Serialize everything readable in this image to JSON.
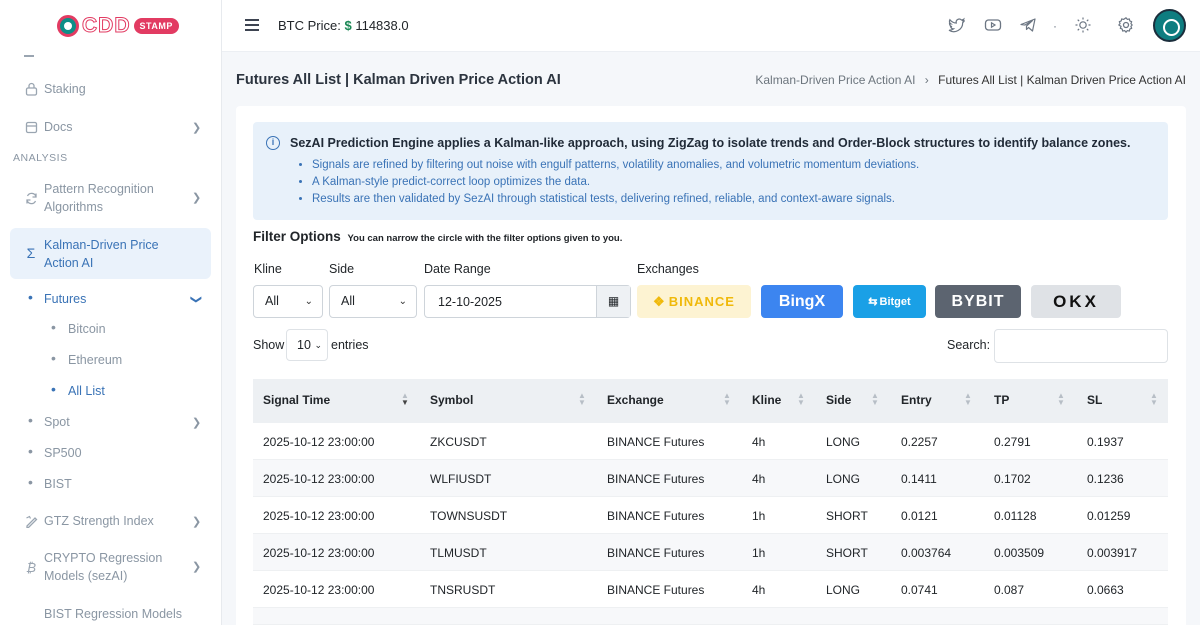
{
  "logo": {
    "text": "CDD",
    "badge": "STAMP"
  },
  "header": {
    "btc_label": "BTC Price:",
    "btc_currency": "$",
    "btc_value": "114838.0"
  },
  "sidebar": {
    "section_analysis": "ANALYSIS",
    "items": [
      {
        "label": "Staking"
      },
      {
        "label": "Docs"
      },
      {
        "label": "Pattern Recognition Algorithms"
      },
      {
        "label": "Kalman-Driven Price Action AI"
      },
      {
        "label": "Futures"
      },
      {
        "label": "Bitcoin"
      },
      {
        "label": "Ethereum"
      },
      {
        "label": "All List"
      },
      {
        "label": "Spot"
      },
      {
        "label": "SP500"
      },
      {
        "label": "BIST"
      },
      {
        "label": "GTZ Strength Index"
      },
      {
        "label": "CRYPTO Regression Models (sezAI)"
      },
      {
        "label": "BIST Regression Models"
      }
    ]
  },
  "page": {
    "title": "Futures All List | Kalman Driven Price Action AI",
    "breadcrumb": [
      "Kalman-Driven Price Action AI",
      "Futures All List | Kalman Driven Price Action AI"
    ],
    "breadcrumb_sep": "›"
  },
  "alert": {
    "head": "SezAI Prediction Engine applies a Kalman-like approach, using ZigZag to isolate trends and Order-Block structures to identify balance zones.",
    "bullets": [
      "Signals are refined by filtering out noise with engulf patterns, volatility anomalies, and volumetric momentum deviations.",
      "A Kalman-style predict-correct loop optimizes the data.",
      "Results are then validated by SezAI through statistical tests, delivering refined, reliable, and context-aware signals."
    ]
  },
  "filters": {
    "title": "Filter Options",
    "subtitle": "You can narrow the circle with the filter options given to you.",
    "kline_label": "Kline",
    "kline_value": "All",
    "side_label": "Side",
    "side_value": "All",
    "date_label": "Date Range",
    "date_value": "12-10-2025",
    "exchanges_label": "Exchanges",
    "exchanges": [
      "BINANCE",
      "BingX",
      "Bitget",
      "BYBIT",
      "OKX"
    ]
  },
  "table_controls": {
    "show": "Show",
    "entries_value": "10",
    "entries": "entries",
    "search": "Search:"
  },
  "table": {
    "columns": [
      "Signal Time",
      "Symbol",
      "Exchange",
      "Kline",
      "Side",
      "Entry",
      "TP",
      "SL"
    ],
    "rows": [
      [
        "2025-10-12 23:00:00",
        "ZKCUSDT",
        "BINANCE Futures",
        "4h",
        "LONG",
        "0.2257",
        "0.2791",
        "0.1937"
      ],
      [
        "2025-10-12 23:00:00",
        "WLFIUSDT",
        "BINANCE Futures",
        "4h",
        "LONG",
        "0.1411",
        "0.1702",
        "0.1236"
      ],
      [
        "2025-10-12 23:00:00",
        "TOWNSUSDT",
        "BINANCE Futures",
        "1h",
        "SHORT",
        "0.0121",
        "0.01128",
        "0.01259"
      ],
      [
        "2025-10-12 23:00:00",
        "TLMUSDT",
        "BINANCE Futures",
        "1h",
        "SHORT",
        "0.003764",
        "0.003509",
        "0.003917"
      ],
      [
        "2025-10-12 23:00:00",
        "TNSRUSDT",
        "BINANCE Futures",
        "4h",
        "LONG",
        "0.0741",
        "0.087",
        "0.0663"
      ]
    ]
  }
}
